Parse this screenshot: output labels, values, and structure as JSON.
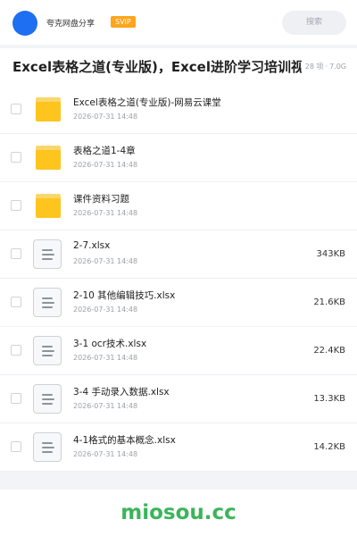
{
  "header": {
    "share_name": "夸克网盘分享",
    "svip_badge": "SVIP",
    "search_placeholder": "搜索"
  },
  "title_bar": {
    "title": "Excel表格之道(专业版)，Excel进阶学习培训视频",
    "count": "28 项",
    "separator": "·",
    "total_size": "7.0G"
  },
  "files": [
    {
      "type": "folder",
      "name": "Excel表格之道(专业版)-网易云课堂",
      "time": "2026-07-31 14:48",
      "size": ""
    },
    {
      "type": "folder",
      "name": "表格之道1-4章",
      "time": "2026-07-31 14:48",
      "size": ""
    },
    {
      "type": "folder",
      "name": "课件资料习题",
      "time": "2026-07-31 14:48",
      "size": ""
    },
    {
      "type": "file",
      "name": "2-7.xlsx",
      "time": "2026-07-31 14:48",
      "size": "343KB"
    },
    {
      "type": "file",
      "name": "2-10 其他编辑技巧.xlsx",
      "time": "2026-07-31 14:48",
      "size": "21.6KB"
    },
    {
      "type": "file",
      "name": "3-1 ocr技术.xlsx",
      "time": "2026-07-31 14:48",
      "size": "22.4KB"
    },
    {
      "type": "file",
      "name": "3-4 手动录入数据.xlsx",
      "time": "2026-07-31 14:48",
      "size": "13.3KB"
    },
    {
      "type": "file",
      "name": "4-1格式的基本概念.xlsx",
      "time": "2026-07-31 14:48",
      "size": "14.2KB"
    }
  ],
  "footer": {
    "watermark": "miosou.cc"
  },
  "colors": {
    "avatar": "#1e6ff1",
    "svip": "#ffa41c",
    "folder": "#ffc51f",
    "watermark": "#3ab55a"
  }
}
